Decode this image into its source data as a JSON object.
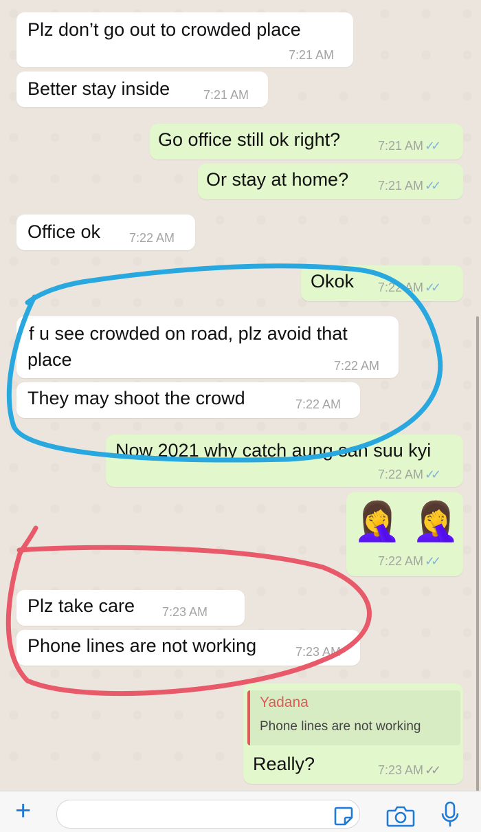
{
  "messages": [
    {
      "text": "Plz don’t go out to crowded place",
      "time": "7:21 AM"
    },
    {
      "text": "Better stay inside",
      "time": "7:21 AM"
    },
    {
      "text": "Go office still ok right?",
      "time": "7:21 AM"
    },
    {
      "text": "Or stay at home?",
      "time": "7:21 AM"
    },
    {
      "text": "Office ok",
      "time": "7:22 AM"
    },
    {
      "text": "Okok",
      "time": "7:22 AM"
    },
    {
      "text_line1": "f u see crowded on road, plz avoid that",
      "text_line2": "place",
      "time": "7:22 AM"
    },
    {
      "text": "They may shoot the crowd",
      "time": "7:22 AM"
    },
    {
      "text": "Now 2021 why catch aung san suu kyi",
      "time": "7:22 AM"
    },
    {
      "emoji": "🤦‍♀️ 🤦‍♀️",
      "time": "7:22 AM"
    },
    {
      "text": "Plz take care",
      "time": "7:23 AM"
    },
    {
      "text": "Phone lines are not working",
      "time": "7:23 AM"
    },
    {
      "reply_author": "Yadana",
      "reply_text": "Phone lines are not working",
      "text": "Really?",
      "time": "7:23 AM"
    }
  ],
  "ticks": "✓✓",
  "icons": {
    "add": "plus-icon",
    "sticker": "sticker-icon",
    "camera": "camera-icon",
    "mic": "microphone-icon"
  },
  "colors": {
    "incoming": "#ffffff",
    "outgoing": "#e2f7cb",
    "accent": "#1f7ad7",
    "annotation_blue": "#29a8e0",
    "annotation_red": "#e85a6a"
  }
}
